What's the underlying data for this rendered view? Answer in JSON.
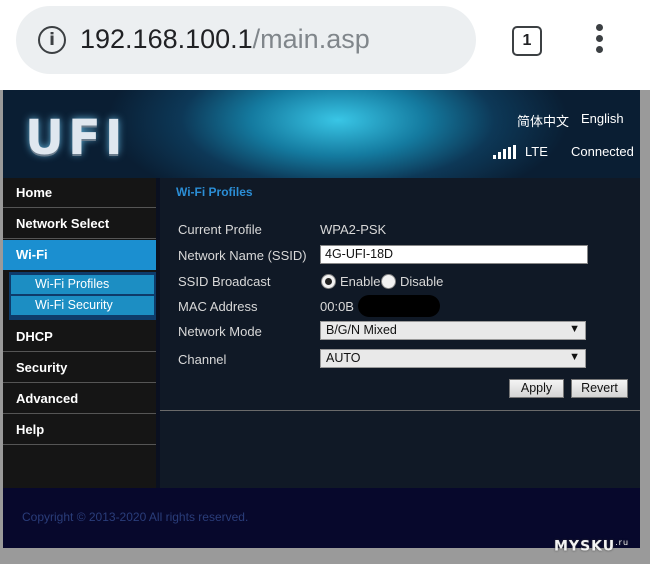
{
  "browser": {
    "host": "192.168.100.1",
    "path": "/main.asp",
    "tab_count": "1"
  },
  "header": {
    "logo": "UFI",
    "lang_cn": "简体中文",
    "lang_en": "English",
    "network_type": "LTE",
    "connection_status": "Connected"
  },
  "nav": {
    "items": [
      {
        "label": "Home"
      },
      {
        "label": "Network Select"
      },
      {
        "label": "Wi-Fi"
      },
      {
        "label": "DHCP"
      },
      {
        "label": "Security"
      },
      {
        "label": "Advanced"
      },
      {
        "label": "Help"
      }
    ],
    "sub_items": [
      {
        "label": "Wi-Fi Profiles"
      },
      {
        "label": "Wi-Fi Security"
      }
    ]
  },
  "content": {
    "section_title": "Wi-Fi Profiles",
    "current_profile_label": "Current Profile",
    "current_profile_value": "WPA2-PSK",
    "ssid_label": "Network Name (SSID)",
    "ssid_value": "4G-UFI-18D",
    "broadcast_label": "SSID Broadcast",
    "broadcast_enable": "Enable",
    "broadcast_disable": "Disable",
    "mac_label": "MAC Address",
    "mac_value": "00:0B",
    "mode_label": "Network Mode",
    "mode_value": "B/G/N Mixed",
    "channel_label": "Channel",
    "channel_value": "AUTO",
    "apply_label": "Apply",
    "revert_label": "Revert"
  },
  "footer": {
    "copyright": "Copyright © 2013-2020 All rights reserved."
  },
  "watermark": {
    "text": "MYSKU",
    "suffix": ".ru"
  },
  "colors": {
    "nav_active": "#1b8fd0",
    "section_title": "#2b8ed6",
    "footer_bg": "#07082c"
  },
  "icons": [
    "info-icon",
    "signal-icon",
    "menu-icon",
    "chevron-down-icon"
  ]
}
